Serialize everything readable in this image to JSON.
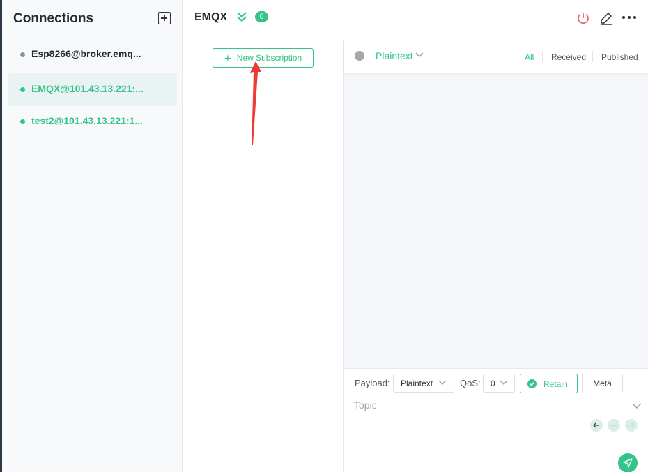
{
  "sidebar": {
    "title": "Connections",
    "connections": [
      {
        "label": "Esp8266@broker.emq...",
        "status_color": "#8d9299",
        "label_color": "#23282d",
        "active": false
      },
      {
        "label": "EMQX@101.43.13.221:...",
        "status_color": "#34c388",
        "label_color": "#34c388",
        "active": true
      },
      {
        "label": "test2@101.43.13.221:1...",
        "status_color": "#34c388",
        "label_color": "#34c388",
        "active": false
      }
    ]
  },
  "header": {
    "connection_name": "EMQX",
    "subscription_count": "0",
    "icons": [
      "double-chevron-down-icon",
      "power-icon",
      "edit-icon",
      "more-icon"
    ]
  },
  "subscriptions": {
    "new_subscription_label": "New Subscription"
  },
  "messages": {
    "payload_format": "Plaintext",
    "filters": [
      "All",
      "Received",
      "Published"
    ],
    "active_filter": "All"
  },
  "composer": {
    "payload_label": "Payload:",
    "payload_value": "Plaintext",
    "qos_label": "QoS:",
    "qos_value": "0",
    "retain_label": "Retain",
    "retain_checked": true,
    "meta_label": "Meta",
    "topic_placeholder": "Topic"
  },
  "colors": {
    "accent": "#34c388",
    "power_icon": "#e55b5b",
    "annotation_arrow": "#ee3b35"
  }
}
